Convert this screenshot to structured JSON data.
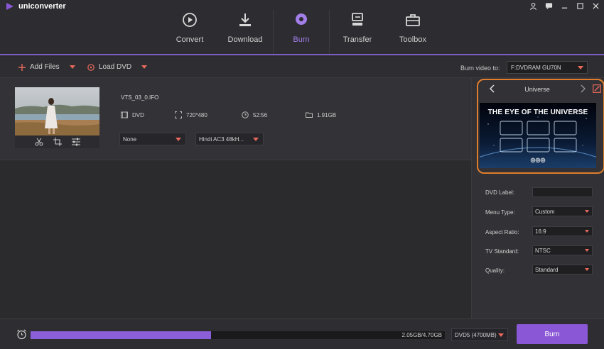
{
  "app": {
    "name": "uniconverter"
  },
  "nav": {
    "tabs": [
      {
        "label": "Convert",
        "icon": "convert-icon"
      },
      {
        "label": "Download",
        "icon": "download-icon"
      },
      {
        "label": "Burn",
        "icon": "burn-icon",
        "active": true
      },
      {
        "label": "Transfer",
        "icon": "transfer-icon"
      },
      {
        "label": "Toolbox",
        "icon": "toolbox-icon"
      }
    ]
  },
  "toolbar": {
    "add_files_label": "Add Files",
    "load_dvd_label": "Load DVD",
    "burn_to_label": "Burn video to:",
    "burn_to_value": "F:DVDRAM GU70N"
  },
  "file": {
    "name": "VTS_03_0.IFO",
    "format": "DVD",
    "resolution": "720*480",
    "duration": "52:56",
    "size": "1.91GB",
    "subtitle_value": "None",
    "audio_value": "Hindi AC3 48kH..."
  },
  "template": {
    "name": "Universe",
    "preview_title": "THE EYE OF THE UNIVERSE",
    "preview_footer": "◎◎◎"
  },
  "settings": {
    "dvd_label": {
      "label": "DVD Label:",
      "value": ""
    },
    "menu_type": {
      "label": "Menu Type:",
      "value": "Custom"
    },
    "aspect_ratio": {
      "label": "Aspect Ratio:",
      "value": "16:9"
    },
    "tv_standard": {
      "label": "TV Standard:",
      "value": "NTSC"
    },
    "quality": {
      "label": "Quality:",
      "value": "Standard"
    }
  },
  "bottom": {
    "progress_fraction": 0.436,
    "progress_text": "2.05GB/4.70GB",
    "disc_value": "DVD5 (4700MB)",
    "burn_label": "Burn"
  },
  "colors": {
    "accent": "#8a58d6",
    "highlight": "#e07d2c",
    "caret": "#e8685b"
  }
}
